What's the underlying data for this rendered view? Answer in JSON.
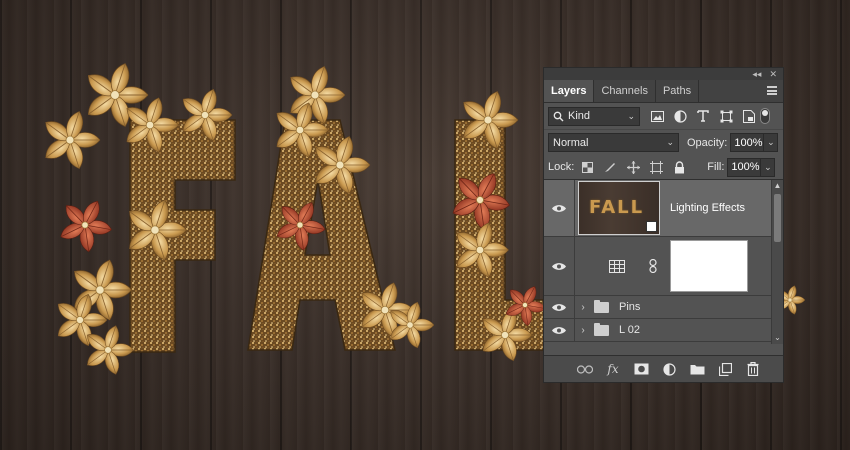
{
  "artwork": {
    "word": "FALL"
  },
  "panel": {
    "top_controls": {
      "collapse": "◂◂",
      "close": "✕"
    },
    "tabs": [
      {
        "label": "Layers",
        "active": true
      },
      {
        "label": "Channels",
        "active": false
      },
      {
        "label": "Paths",
        "active": false
      }
    ],
    "filter": {
      "kind_label": "Kind",
      "icons": [
        "image-filter-icon",
        "adjustment-filter-icon",
        "type-filter-icon",
        "shape-filter-icon",
        "smart-object-filter-icon"
      ]
    },
    "blend": {
      "mode": "Normal",
      "opacity_label": "Opacity:",
      "opacity_value": "100%",
      "fill_label": "Fill:",
      "fill_value": "100%"
    },
    "lock": {
      "label": "Lock:",
      "icons": [
        "lock-transparent-icon",
        "lock-image-icon",
        "lock-position-icon",
        "lock-artboard-icon",
        "lock-all-icon"
      ]
    },
    "layers": [
      {
        "type": "smart-object",
        "name": "Lighting Effects",
        "thumb_text": "FALL",
        "selected": true,
        "visible": true
      },
      {
        "type": "adjustment",
        "name": "",
        "visible": true
      },
      {
        "type": "group",
        "name": "Pins",
        "visible": true
      },
      {
        "type": "group",
        "name": "L 02",
        "visible": true
      }
    ],
    "footer_icons": [
      "link-layers-icon",
      "fx-icon",
      "add-mask-icon",
      "new-adjustment-icon",
      "new-group-icon",
      "new-layer-icon",
      "delete-layer-icon"
    ],
    "footer_labels": {
      "fx": "fx"
    }
  },
  "colors": {
    "panel_bg": "#535353",
    "selected_row": "#686868",
    "wood": "#3a2f29",
    "gold": "#c9994f",
    "red_leaf": "#b84a32"
  }
}
